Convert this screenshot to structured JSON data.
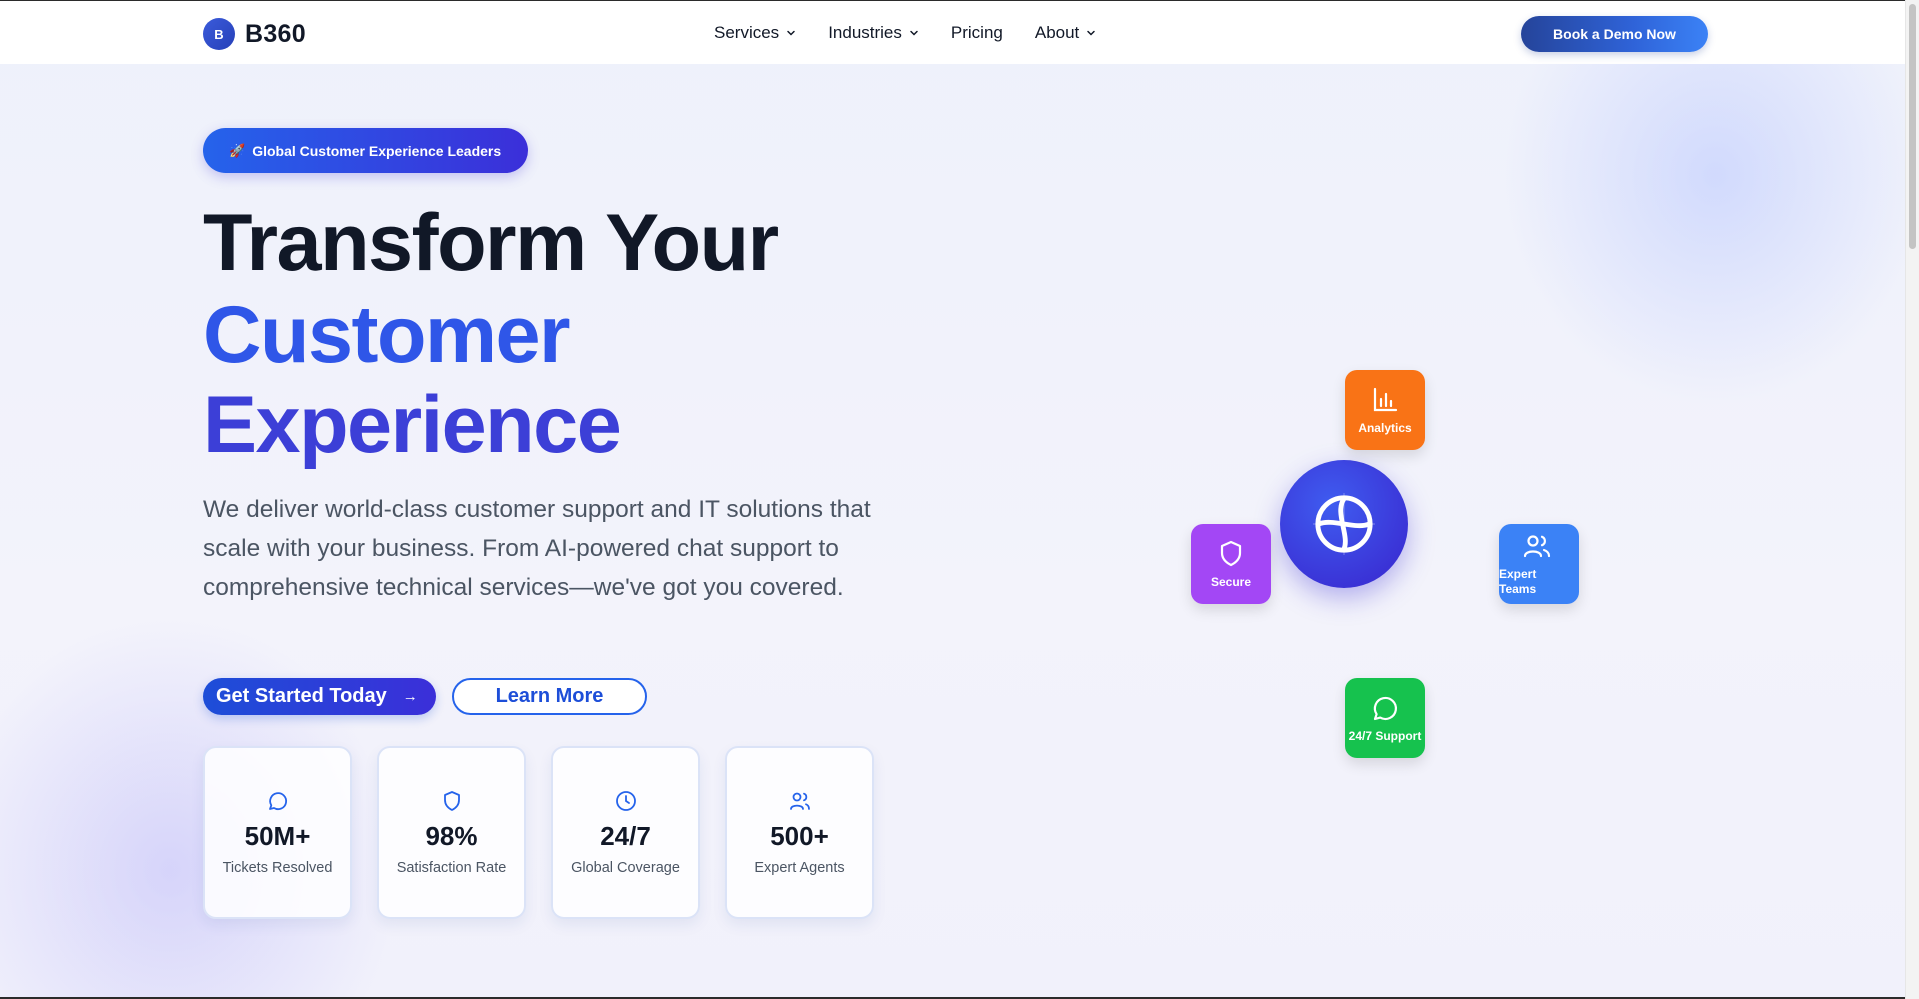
{
  "header": {
    "logo_letter": "B",
    "logo_text": "B360",
    "nav": [
      {
        "label": "Services",
        "has_dropdown": true
      },
      {
        "label": "Industries",
        "has_dropdown": true
      },
      {
        "label": "Pricing",
        "has_dropdown": false
      },
      {
        "label": "About",
        "has_dropdown": true
      }
    ],
    "cta_label": "Book a Demo Now"
  },
  "hero": {
    "badge_icon": "rocket-icon",
    "badge_label": "Global Customer Experience Leaders",
    "title_line1": "Transform Your",
    "title_line2": "Customer",
    "title_line3": "Experience",
    "lead": "We deliver world-class customer support and IT solutions that scale with your business. From AI-powered chat support to comprehensive technical services—we've got you covered.",
    "primary_button": "Get Started Today",
    "secondary_button": "Learn More"
  },
  "stats": [
    {
      "icon": "chat-bubble-icon",
      "value": "50M+",
      "label": "Tickets Resolved"
    },
    {
      "icon": "shield-icon",
      "value": "98%",
      "label": "Satisfaction Rate"
    },
    {
      "icon": "clock-icon",
      "value": "24/7",
      "label": "Global Coverage"
    },
    {
      "icon": "users-icon",
      "value": "500+",
      "label": "Expert Agents"
    }
  ],
  "orbit": {
    "hub_icon": "globe-icon",
    "tiles": [
      {
        "label": "Analytics",
        "icon": "bar-chart-icon",
        "color": "#f97316"
      },
      {
        "label": "Secure",
        "icon": "shield-icon",
        "color": "#a347f5"
      },
      {
        "label": "Expert Teams",
        "icon": "users-icon",
        "color": "#3b82f6"
      },
      {
        "label": "24/7 Support",
        "icon": "chat-bubble-icon",
        "color": "#16c24e"
      }
    ]
  },
  "colors": {
    "primary": "#2563eb",
    "accent_indigo": "#3b2fd9",
    "heading": "#111827"
  }
}
